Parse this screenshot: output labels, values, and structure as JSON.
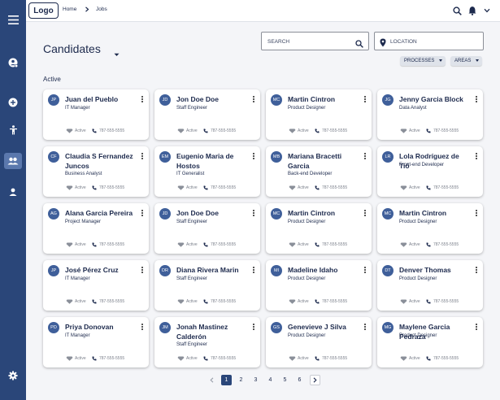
{
  "header": {
    "logo": "Logo",
    "breadcrumb": [
      "Home",
      "Jobs"
    ]
  },
  "page": {
    "title": "Candidates",
    "section_label": "Active"
  },
  "filters": {
    "search_placeholder": "SEARCH",
    "location_placeholder": "LOCATION",
    "processes_label": "PROCESSES",
    "areas_label": "AREAS"
  },
  "colors": {
    "sidebar": "#2a4679",
    "accent": "#3f5f9a",
    "background": "#f4f5f8"
  },
  "sidebar": {
    "icons": [
      "menu-icon",
      "add-user-icon",
      "add-icon",
      "accessibility-icon",
      "people-icon",
      "person-icon",
      "settings-icon"
    ],
    "active": "people-icon"
  },
  "candidates": [
    {
      "initials": "JP",
      "name": "Juan del Pueblo",
      "role": "IT Manager",
      "status": "Active",
      "phone": "787-555-5555"
    },
    {
      "initials": "JD",
      "name": "Jon Doe Doe",
      "role": "Staff Engineer",
      "status": "Active",
      "phone": "787-555-5555"
    },
    {
      "initials": "MC",
      "name": "Martin Cintron",
      "role": "Product Designer",
      "status": "Active",
      "phone": "787-555-5555"
    },
    {
      "initials": "JG",
      "name": "Jenny Garcia Block",
      "role": "Data Analyst",
      "status": "Active",
      "phone": "787-555-5555"
    },
    {
      "initials": "CF",
      "name": "Claudia S Fernandez Juncos",
      "role": "Business Analyst",
      "status": "Active",
      "phone": "787-555-5555"
    },
    {
      "initials": "EM",
      "name": "Eugenio Maria de Hostos",
      "role": "IT Generalist",
      "status": "Active",
      "phone": "787-555-5555"
    },
    {
      "initials": "MB",
      "name": "Mariana Bracetti Garcia",
      "role": "Back-end Developer",
      "status": "Active",
      "phone": "787-555-5555"
    },
    {
      "initials": "LR",
      "name": "Lola Rodríguez de Tió",
      "role": "Front-end Developer",
      "status": "Active",
      "phone": "787-555-5555"
    },
    {
      "initials": "AG",
      "name": "Alana Garcia Pereira",
      "role": "Project Manager",
      "status": "Active",
      "phone": "787-555-5555"
    },
    {
      "initials": "JD",
      "name": "Jon Doe Doe",
      "role": "Staff Engineer",
      "status": "Active",
      "phone": "787-555-5555"
    },
    {
      "initials": "MC",
      "name": "Martin Cintron",
      "role": "Product Designer",
      "status": "Active",
      "phone": "787-555-5555"
    },
    {
      "initials": "MC",
      "name": "Martin Cintron",
      "role": "Product Designer",
      "status": "Active",
      "phone": "787-555-5555"
    },
    {
      "initials": "JP",
      "name": "José Pérez Cruz",
      "role": "IT Manager",
      "status": "Active",
      "phone": "787-555-5555"
    },
    {
      "initials": "DR",
      "name": "Diana Rivera Marin",
      "role": "Staff Engineer",
      "status": "Active",
      "phone": "787-555-5555"
    },
    {
      "initials": "MI",
      "name": "Madeline Idaho",
      "role": "Product Designer",
      "status": "Active",
      "phone": "787-555-5555"
    },
    {
      "initials": "DT",
      "name": "Denver Thomas",
      "role": "Product Designer",
      "status": "Active",
      "phone": "787-555-5555"
    },
    {
      "initials": "PD",
      "name": "Priya Donovan",
      "role": "IT Manager",
      "status": "Active",
      "phone": "787-555-5555"
    },
    {
      "initials": "JM",
      "name": "Jonah Mastinez Calderón",
      "role": "Staff Engineer",
      "status": "Active",
      "phone": "787-555-5555"
    },
    {
      "initials": "GS",
      "name": "Genevieve J Silva",
      "role": "Product Designer",
      "status": "Active",
      "phone": "787-555-5555"
    },
    {
      "initials": "MG",
      "name": "Maylene Garcia Pedraza",
      "role": "Product Designer",
      "status": "Active",
      "phone": "787-555-5555"
    }
  ],
  "pagination": {
    "pages": [
      "1",
      "2",
      "3",
      "4",
      "5",
      "6"
    ],
    "current": "1"
  }
}
